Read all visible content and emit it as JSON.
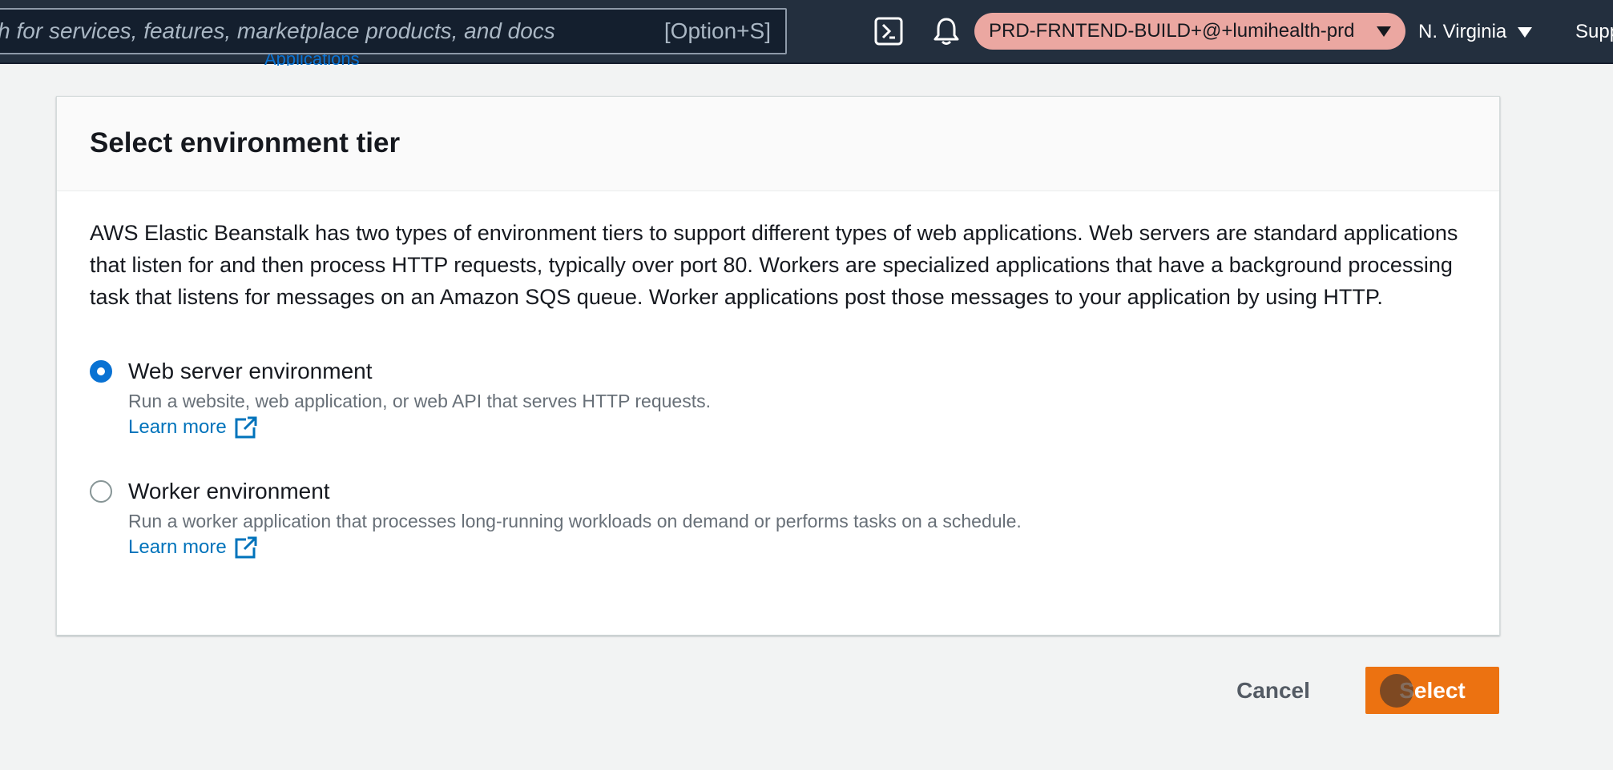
{
  "topnav": {
    "search_placeholder": "Search for services, features, marketplace products, and docs",
    "search_shortcut": "[Option+S]",
    "account_label": "PRD-FRNTEND-BUILD+@+lumihealth-prd",
    "region_label": "N. Virginia",
    "support_label": "Support",
    "icons": [
      "cloudshell-icon",
      "bell-icon"
    ]
  },
  "underlay": {
    "breadcrumb_fragment": "Applications"
  },
  "modal": {
    "title": "Select environment tier",
    "description": "AWS Elastic Beanstalk has two types of environment tiers to support different types of web applications. Web servers are standard applications that listen for and then process HTTP requests, typically over port 80. Workers are specialized applications that have a background processing task that listens for messages on an Amazon SQS queue. Worker applications post those messages to your application by using HTTP.",
    "options": [
      {
        "label": "Web server environment",
        "description": "Run a website, web application, or web API that serves HTTP requests.",
        "learn_more": "Learn more",
        "selected": true
      },
      {
        "label": "Worker environment",
        "description": "Run a worker application that processes long-running workloads on demand or performs tasks on a schedule.",
        "learn_more": "Learn more",
        "selected": false
      }
    ],
    "cancel_label": "Cancel",
    "select_label": "Select"
  },
  "colors": {
    "nav_bg": "#232f3e",
    "account_pill": "#eba7a1",
    "primary_button": "#ec7211",
    "link": "#0073bb",
    "radio_selected": "#0972d3"
  }
}
